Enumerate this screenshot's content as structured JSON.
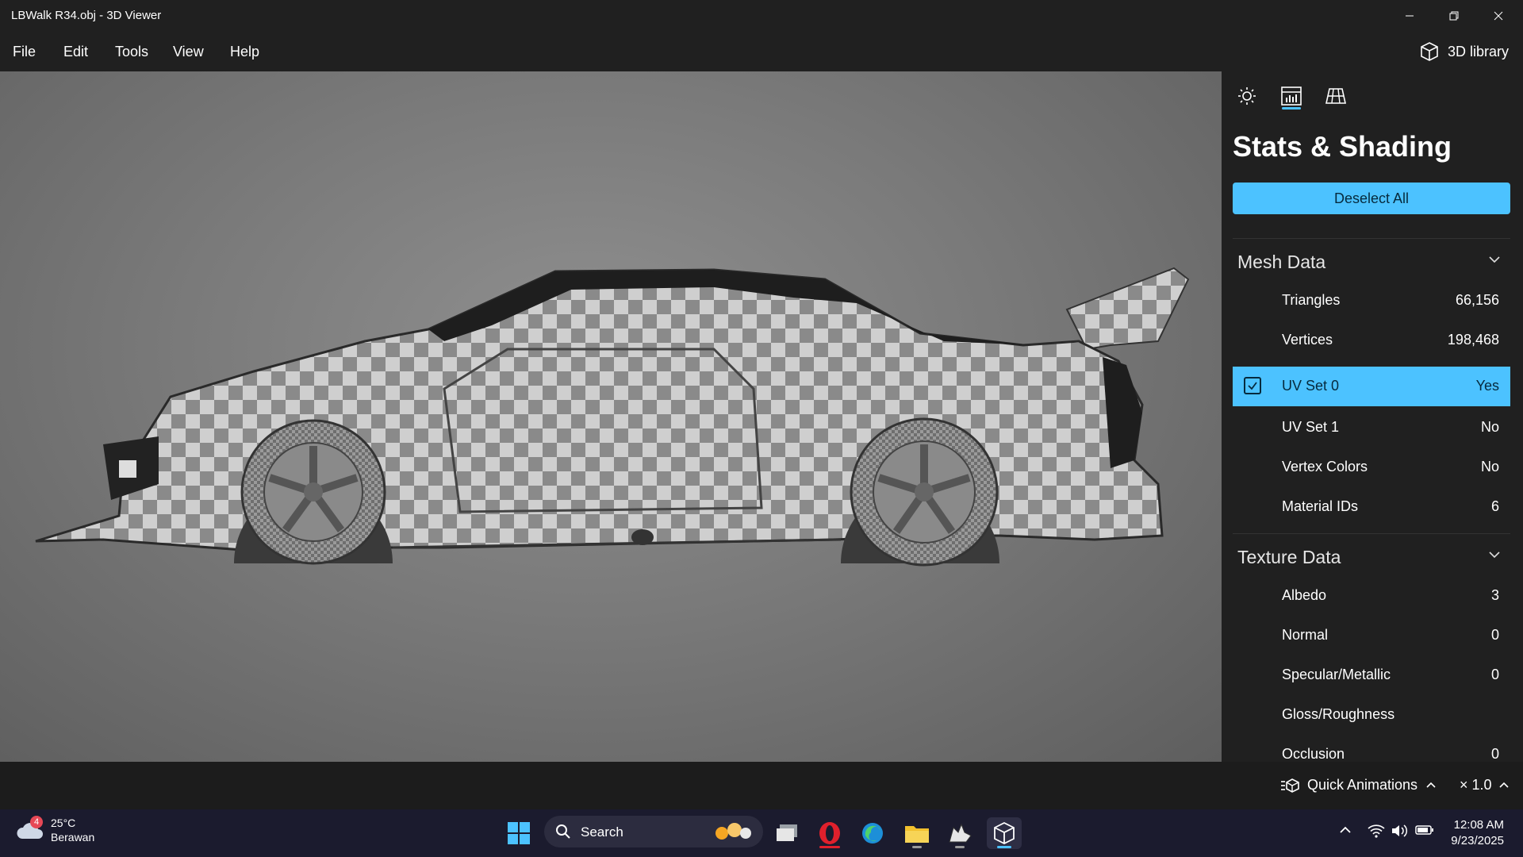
{
  "window": {
    "title": "LBWalk R34.obj - 3D Viewer",
    "controls": [
      "minimize-icon",
      "restore-icon",
      "close-icon"
    ]
  },
  "menu": {
    "items": [
      "File",
      "Edit",
      "Tools",
      "View",
      "Help"
    ],
    "library_label": "3D library"
  },
  "panel": {
    "tabs": [
      {
        "icon": "sun-icon",
        "active": false
      },
      {
        "icon": "stats-icon",
        "active": true
      },
      {
        "icon": "grid-icon",
        "active": false
      }
    ],
    "title": "Stats & Shading",
    "deselect_label": "Deselect All",
    "mesh_section": {
      "title": "Mesh Data",
      "rows": [
        {
          "label": "Triangles",
          "value": "66,156"
        },
        {
          "label": "Vertices",
          "value": "198,468"
        },
        {
          "label": "UV Set 0",
          "value": "Yes",
          "selected": true
        },
        {
          "label": "UV Set 1",
          "value": "No"
        },
        {
          "label": "Vertex Colors",
          "value": "No"
        },
        {
          "label": "Material IDs",
          "value": "6"
        }
      ]
    },
    "texture_section": {
      "title": "Texture Data",
      "rows": [
        {
          "label": "Albedo",
          "value": "3"
        },
        {
          "label": "Normal",
          "value": "0"
        },
        {
          "label": "Specular/Metallic",
          "value": "0"
        },
        {
          "label": "Gloss/Roughness",
          "value": ""
        },
        {
          "label": "Occlusion",
          "value": "0"
        }
      ]
    }
  },
  "bottom": {
    "quick_animations_label": "Quick Animations",
    "speed_label": "× 1.0"
  },
  "taskbar": {
    "weather": {
      "temp": "25°C",
      "condition": "Berawan",
      "badge": "4"
    },
    "search_label": "Search",
    "apps": [
      "windows-start-icon",
      "task-view-icon",
      "opera-icon",
      "edge-icon",
      "file-explorer-icon",
      "rhino-icon",
      "3d-viewer-icon"
    ],
    "time": "12:08 AM",
    "date": "9/23/2025"
  },
  "colors": {
    "accent": "#4cc2ff",
    "background": "#202020",
    "taskbar": "#1b1b2e"
  }
}
